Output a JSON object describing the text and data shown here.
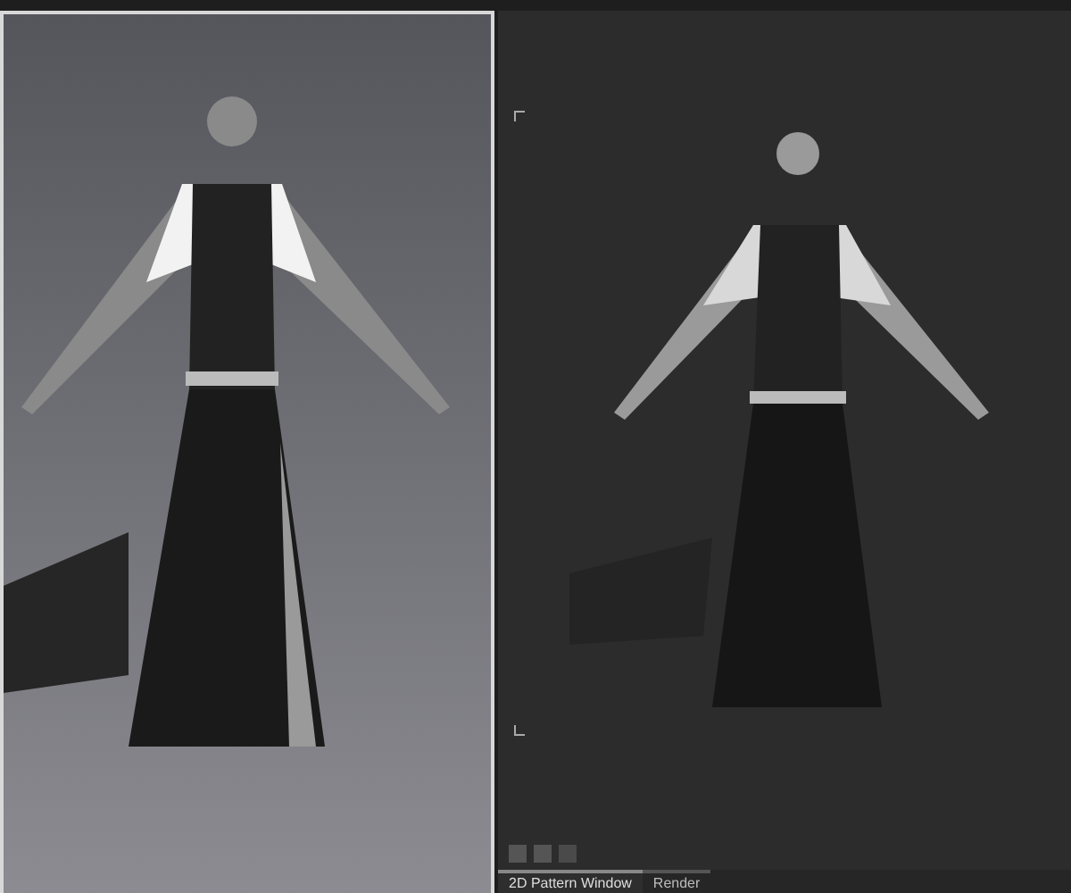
{
  "bottom_tabs": [
    {
      "label": "2D Pattern Window",
      "selected": true
    },
    {
      "label": "Render",
      "selected": false
    }
  ]
}
